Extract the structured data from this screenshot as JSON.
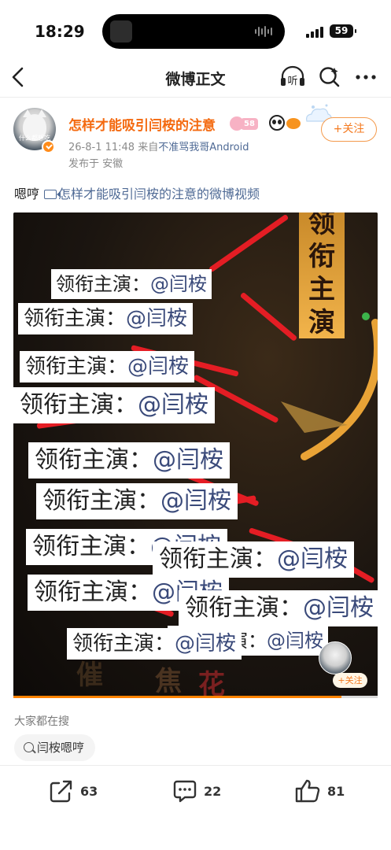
{
  "status_bar": {
    "time": "18:29",
    "battery": "59"
  },
  "nav": {
    "title": "微博正文",
    "listen_label": "听"
  },
  "author": {
    "name": "怎样才能吸引闫桉的注意",
    "level": "58",
    "avatar_caption": "什么都想吃",
    "follow_label": "+关注",
    "timestamp": "26-8-1 11:48",
    "source_prefix": "来自",
    "source": "不准骂我哥Android",
    "location": "发布于 安徽"
  },
  "post": {
    "text": "嗯哼",
    "video_link": "怎样才能吸引闫桉的注意的微博视频"
  },
  "video": {
    "banner_text": [
      "领",
      "衔",
      "主",
      "演"
    ],
    "caption_role": "领衔主演：",
    "caption_name": "@闫桉",
    "bottom_text": [
      "催",
      "焦",
      "花"
    ],
    "follow_label": "+关注",
    "progress_fraction": 0.9
  },
  "hot_search": {
    "title": "大家都在搜",
    "items": [
      "闫桉嗯哼"
    ]
  },
  "actions": {
    "share_count": "63",
    "comment_count": "22",
    "like_count": "81"
  },
  "colors": {
    "accent": "#ff8200",
    "link": "#4f6a95",
    "name": "#f46a10",
    "caption_red": "#e41d24"
  }
}
